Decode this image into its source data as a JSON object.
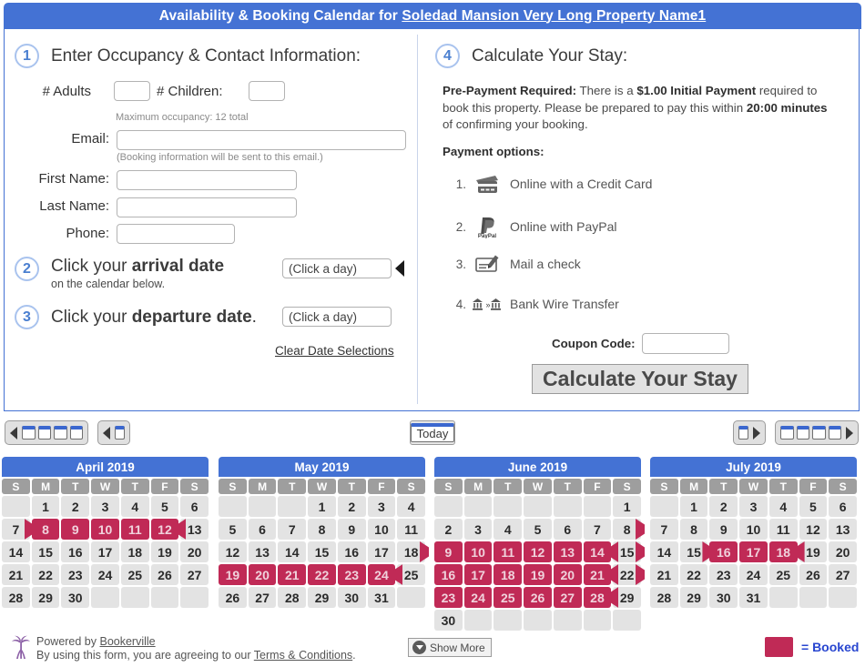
{
  "header": {
    "title_prefix": "Availability & Booking Calendar for ",
    "property_name": "Soledad Mansion Very Long Property Name1"
  },
  "step1": {
    "number": "1",
    "heading": "Enter Occupancy & Contact Information:",
    "adults_label": "# Adults",
    "adults_value": "",
    "children_label": "# Children:",
    "children_value": "",
    "occupancy_hint": "Maximum occupancy: 12 total",
    "email_label": "Email:",
    "email_value": "",
    "email_hint": "(Booking information will be sent to this email.)",
    "first_name_label": "First Name:",
    "first_name_value": "",
    "last_name_label": "Last Name:",
    "last_name_value": "",
    "phone_label": "Phone:",
    "phone_value": ""
  },
  "step2": {
    "number": "2",
    "heading_plain": "Click your ",
    "heading_bold": "arrival date",
    "subtext": "on the calendar below.",
    "date_value": "(Click a day)"
  },
  "step3": {
    "number": "3",
    "heading_plain": "Click your ",
    "heading_bold": "departure date",
    "heading_suffix": ".",
    "date_value": "(Click a day)",
    "clear_link": "Clear Date Selections"
  },
  "step4": {
    "number": "4",
    "heading": "Calculate Your Stay:",
    "prepay_label": "Pre-Payment Required:",
    "prepay_text_1": " There is a ",
    "prepay_amount": "$1.00 Initial Payment",
    "prepay_text_2": " required to book this property. Please be prepared to pay this within ",
    "prepay_time": "20:00 minutes",
    "prepay_text_3": " of confirming your booking.",
    "payment_options_label": "Payment options:",
    "payment_options": [
      {
        "num": "1.",
        "icon": "credit-card-icon",
        "label": "Online with a Credit Card"
      },
      {
        "num": "2.",
        "icon": "paypal-icon",
        "label": "Online with PayPal"
      },
      {
        "num": "3.",
        "icon": "check-pen-icon",
        "label": "Mail a check"
      },
      {
        "num": "4.",
        "icon": "bank-wire-icon",
        "label": "Bank Wire Transfer"
      }
    ],
    "coupon_label": "Coupon Code:",
    "coupon_value": "",
    "calculate_button": "Calculate Your Stay"
  },
  "nav": {
    "back_year_title": "Back 4 months",
    "back_month_title": "Back 1 month",
    "today_label": "Today",
    "forward_month_title": "Forward 1 month",
    "forward_year_title": "Forward 4 months"
  },
  "calendar": {
    "dow": [
      "S",
      "M",
      "T",
      "W",
      "T",
      "F",
      "S"
    ],
    "months": [
      {
        "title": "April 2019",
        "weeks": [
          [
            {
              "d": "",
              "s": "empty"
            },
            {
              "d": "1",
              "s": "free"
            },
            {
              "d": "2",
              "s": "free"
            },
            {
              "d": "3",
              "s": "free"
            },
            {
              "d": "4",
              "s": "free"
            },
            {
              "d": "5",
              "s": "free"
            },
            {
              "d": "6",
              "s": "free"
            }
          ],
          [
            {
              "d": "7",
              "s": "checkin"
            },
            {
              "d": "8",
              "s": "booked"
            },
            {
              "d": "9",
              "s": "booked"
            },
            {
              "d": "10",
              "s": "booked"
            },
            {
              "d": "11",
              "s": "booked"
            },
            {
              "d": "12",
              "s": "booked"
            },
            {
              "d": "13",
              "s": "checkout"
            }
          ],
          [
            {
              "d": "14",
              "s": "free"
            },
            {
              "d": "15",
              "s": "free"
            },
            {
              "d": "16",
              "s": "free"
            },
            {
              "d": "17",
              "s": "free"
            },
            {
              "d": "18",
              "s": "free"
            },
            {
              "d": "19",
              "s": "free"
            },
            {
              "d": "20",
              "s": "free"
            }
          ],
          [
            {
              "d": "21",
              "s": "free"
            },
            {
              "d": "22",
              "s": "free"
            },
            {
              "d": "23",
              "s": "free"
            },
            {
              "d": "24",
              "s": "free"
            },
            {
              "d": "25",
              "s": "free"
            },
            {
              "d": "26",
              "s": "free"
            },
            {
              "d": "27",
              "s": "free"
            }
          ],
          [
            {
              "d": "28",
              "s": "free"
            },
            {
              "d": "29",
              "s": "free"
            },
            {
              "d": "30",
              "s": "free"
            },
            {
              "d": "",
              "s": "empty"
            },
            {
              "d": "",
              "s": "empty"
            },
            {
              "d": "",
              "s": "empty"
            },
            {
              "d": "",
              "s": "empty"
            }
          ]
        ]
      },
      {
        "title": "May 2019",
        "weeks": [
          [
            {
              "d": "",
              "s": "empty"
            },
            {
              "d": "",
              "s": "empty"
            },
            {
              "d": "",
              "s": "empty"
            },
            {
              "d": "1",
              "s": "free"
            },
            {
              "d": "2",
              "s": "free"
            },
            {
              "d": "3",
              "s": "free"
            },
            {
              "d": "4",
              "s": "free"
            }
          ],
          [
            {
              "d": "5",
              "s": "free"
            },
            {
              "d": "6",
              "s": "free"
            },
            {
              "d": "7",
              "s": "free"
            },
            {
              "d": "8",
              "s": "free"
            },
            {
              "d": "9",
              "s": "free"
            },
            {
              "d": "10",
              "s": "free"
            },
            {
              "d": "11",
              "s": "free"
            }
          ],
          [
            {
              "d": "12",
              "s": "free"
            },
            {
              "d": "13",
              "s": "free"
            },
            {
              "d": "14",
              "s": "free"
            },
            {
              "d": "15",
              "s": "free"
            },
            {
              "d": "16",
              "s": "free"
            },
            {
              "d": "17",
              "s": "free"
            },
            {
              "d": "18",
              "s": "checkin"
            }
          ],
          [
            {
              "d": "19",
              "s": "booked"
            },
            {
              "d": "20",
              "s": "booked"
            },
            {
              "d": "21",
              "s": "booked"
            },
            {
              "d": "22",
              "s": "booked"
            },
            {
              "d": "23",
              "s": "booked"
            },
            {
              "d": "24",
              "s": "booked"
            },
            {
              "d": "25",
              "s": "checkout"
            }
          ],
          [
            {
              "d": "26",
              "s": "free"
            },
            {
              "d": "27",
              "s": "free"
            },
            {
              "d": "28",
              "s": "free"
            },
            {
              "d": "29",
              "s": "free"
            },
            {
              "d": "30",
              "s": "free"
            },
            {
              "d": "31",
              "s": "free"
            },
            {
              "d": "",
              "s": "empty"
            }
          ]
        ]
      },
      {
        "title": "June 2019",
        "weeks": [
          [
            {
              "d": "",
              "s": "empty"
            },
            {
              "d": "",
              "s": "empty"
            },
            {
              "d": "",
              "s": "empty"
            },
            {
              "d": "",
              "s": "empty"
            },
            {
              "d": "",
              "s": "empty"
            },
            {
              "d": "",
              "s": "empty"
            },
            {
              "d": "1",
              "s": "free"
            }
          ],
          [
            {
              "d": "2",
              "s": "free"
            },
            {
              "d": "3",
              "s": "free"
            },
            {
              "d": "4",
              "s": "free"
            },
            {
              "d": "5",
              "s": "free"
            },
            {
              "d": "6",
              "s": "free"
            },
            {
              "d": "7",
              "s": "free"
            },
            {
              "d": "8",
              "s": "checkin"
            }
          ],
          [
            {
              "d": "9",
              "s": "booked"
            },
            {
              "d": "10",
              "s": "booked"
            },
            {
              "d": "11",
              "s": "booked"
            },
            {
              "d": "12",
              "s": "booked"
            },
            {
              "d": "13",
              "s": "booked"
            },
            {
              "d": "14",
              "s": "booked"
            },
            {
              "d": "15",
              "s": "turnover"
            }
          ],
          [
            {
              "d": "16",
              "s": "booked"
            },
            {
              "d": "17",
              "s": "booked"
            },
            {
              "d": "18",
              "s": "booked"
            },
            {
              "d": "19",
              "s": "booked"
            },
            {
              "d": "20",
              "s": "booked"
            },
            {
              "d": "21",
              "s": "booked"
            },
            {
              "d": "22",
              "s": "turnover"
            }
          ],
          [
            {
              "d": "23",
              "s": "booked"
            },
            {
              "d": "24",
              "s": "booked"
            },
            {
              "d": "25",
              "s": "booked"
            },
            {
              "d": "26",
              "s": "booked"
            },
            {
              "d": "27",
              "s": "booked"
            },
            {
              "d": "28",
              "s": "booked"
            },
            {
              "d": "29",
              "s": "checkout"
            }
          ],
          [
            {
              "d": "30",
              "s": "free"
            },
            {
              "d": "",
              "s": "empty"
            },
            {
              "d": "",
              "s": "empty"
            },
            {
              "d": "",
              "s": "empty"
            },
            {
              "d": "",
              "s": "empty"
            },
            {
              "d": "",
              "s": "empty"
            },
            {
              "d": "",
              "s": "empty"
            }
          ]
        ]
      },
      {
        "title": "July 2019",
        "weeks": [
          [
            {
              "d": "",
              "s": "empty"
            },
            {
              "d": "1",
              "s": "free"
            },
            {
              "d": "2",
              "s": "free"
            },
            {
              "d": "3",
              "s": "free"
            },
            {
              "d": "4",
              "s": "free"
            },
            {
              "d": "5",
              "s": "free"
            },
            {
              "d": "6",
              "s": "free"
            }
          ],
          [
            {
              "d": "7",
              "s": "free"
            },
            {
              "d": "8",
              "s": "free"
            },
            {
              "d": "9",
              "s": "free"
            },
            {
              "d": "10",
              "s": "free"
            },
            {
              "d": "11",
              "s": "free"
            },
            {
              "d": "12",
              "s": "free"
            },
            {
              "d": "13",
              "s": "free"
            }
          ],
          [
            {
              "d": "14",
              "s": "free"
            },
            {
              "d": "15",
              "s": "checkin"
            },
            {
              "d": "16",
              "s": "booked"
            },
            {
              "d": "17",
              "s": "booked"
            },
            {
              "d": "18",
              "s": "booked"
            },
            {
              "d": "19",
              "s": "checkout"
            },
            {
              "d": "20",
              "s": "free"
            }
          ],
          [
            {
              "d": "21",
              "s": "free"
            },
            {
              "d": "22",
              "s": "free"
            },
            {
              "d": "23",
              "s": "free"
            },
            {
              "d": "24",
              "s": "free"
            },
            {
              "d": "25",
              "s": "free"
            },
            {
              "d": "26",
              "s": "free"
            },
            {
              "d": "27",
              "s": "free"
            }
          ],
          [
            {
              "d": "28",
              "s": "free"
            },
            {
              "d": "29",
              "s": "free"
            },
            {
              "d": "30",
              "s": "free"
            },
            {
              "d": "31",
              "s": "free"
            },
            {
              "d": "",
              "s": "empty"
            },
            {
              "d": "",
              "s": "empty"
            },
            {
              "d": "",
              "s": "empty"
            }
          ]
        ]
      }
    ]
  },
  "footer": {
    "powered_prefix": "Powered by ",
    "powered_link": "Bookerville",
    "terms_prefix": "By using this form, you are agreeing to our ",
    "terms_link": "Terms & Conditions",
    "terms_suffix": ".",
    "show_more": "Show More",
    "legend_label": "= Booked"
  },
  "colors": {
    "brand_blue": "#4472d4",
    "booked": "#c02a56",
    "legend_text": "#2846d0",
    "dow_gray": "#9e9e9e",
    "cell_gray": "#e3e3e3"
  }
}
